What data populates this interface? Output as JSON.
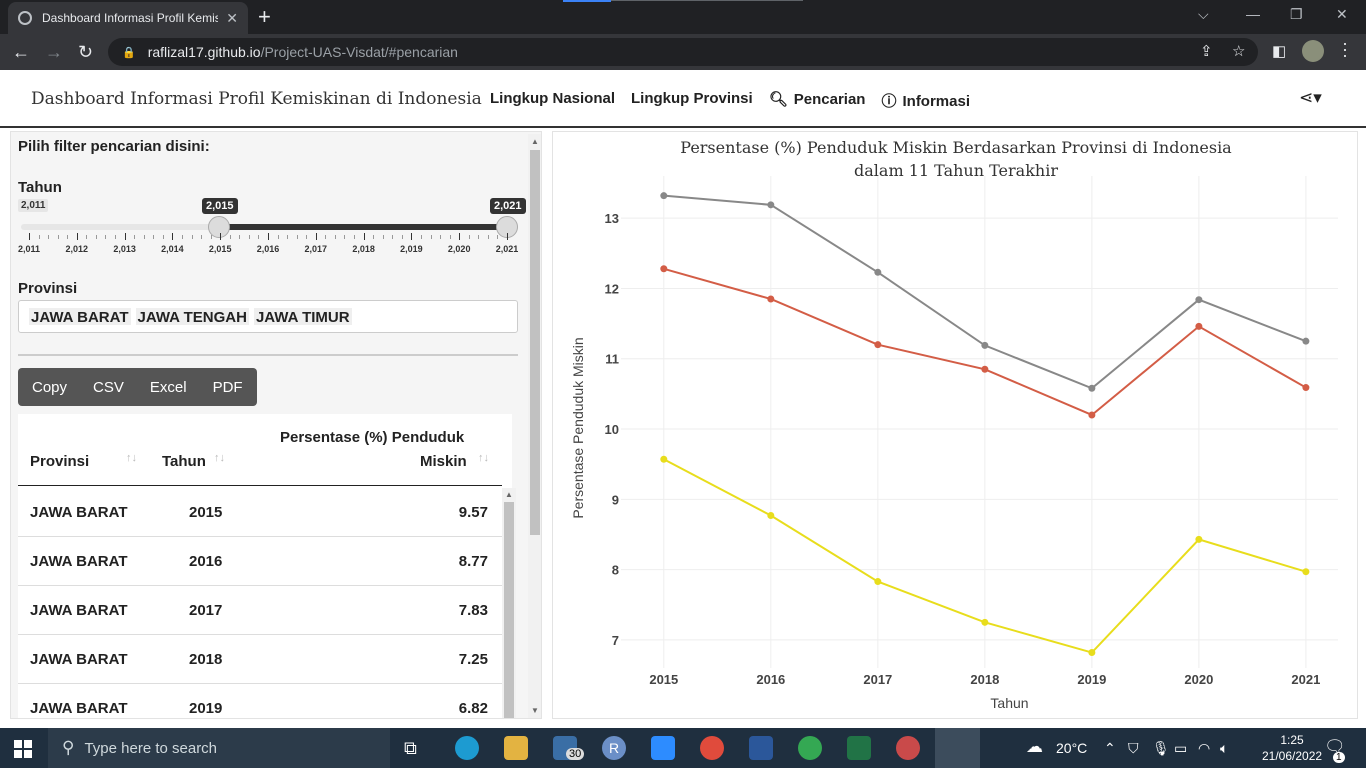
{
  "browser": {
    "tab_title": "Dashboard Informasi Profil Kemis",
    "url_host": "raflizal17.github.io",
    "url_path": "/Project-UAS-Visdat/#pencarian"
  },
  "navbar": {
    "brand": "Dashboard Informasi Profil Kemiskinan di Indonesia",
    "links": [
      "Lingkup Nasional",
      "Lingkup Provinsi",
      "Pencarian",
      "Informasi"
    ]
  },
  "sidebar": {
    "filter_title": "Pilih filter pencarian disini:",
    "tahun_label": "Tahun",
    "slider_min_label": "2,011",
    "slider_from": "2,015",
    "slider_to": "2,021",
    "ticks": [
      "2,011",
      "2,012",
      "2,013",
      "2,014",
      "2,015",
      "2,016",
      "2,017",
      "2,018",
      "2,019",
      "2,020",
      "2,021"
    ],
    "provinsi_label": "Provinsi",
    "selected_provinces": [
      "JAWA BARAT",
      "JAWA TENGAH",
      "JAWA TIMUR"
    ]
  },
  "export_buttons": [
    "Copy",
    "CSV",
    "Excel",
    "PDF"
  ],
  "table": {
    "headers": [
      "Provinsi",
      "Tahun",
      "Persentase (%) Penduduk",
      "Miskin"
    ],
    "rows": [
      [
        "JAWA BARAT",
        "2015",
        "9.57"
      ],
      [
        "JAWA BARAT",
        "2016",
        "8.77"
      ],
      [
        "JAWA BARAT",
        "2017",
        "7.83"
      ],
      [
        "JAWA BARAT",
        "2018",
        "7.25"
      ],
      [
        "JAWA BARAT",
        "2019",
        "6.82"
      ]
    ]
  },
  "chart_data": {
    "type": "line",
    "title_line1": "Persentase (%) Penduduk Miskin Berdasarkan Provinsi di Indonesia",
    "title_line2": "dalam 11 Tahun Terakhir",
    "xlabel": "Tahun",
    "ylabel": "Persentase Penduduk Miskin",
    "x": [
      2015,
      2016,
      2017,
      2018,
      2019,
      2020,
      2021
    ],
    "x_tick_labels": [
      "2015",
      "2016",
      "2017",
      "2018",
      "2019",
      "2020",
      "2021"
    ],
    "y_ticks": [
      7,
      8,
      9,
      10,
      11,
      12,
      13
    ],
    "ylim": [
      6.6,
      13.6
    ],
    "grid": true,
    "series": [
      {
        "color": "#888888",
        "values": [
          13.32,
          13.19,
          12.23,
          11.19,
          10.58,
          11.84,
          11.25
        ]
      },
      {
        "color": "#d35d46",
        "values": [
          12.28,
          11.85,
          11.2,
          10.85,
          10.2,
          11.46,
          10.59
        ]
      },
      {
        "color": "#e8dd1c",
        "values": [
          9.57,
          8.77,
          7.83,
          7.25,
          6.82,
          8.43,
          7.97
        ]
      }
    ]
  },
  "taskbar": {
    "search_placeholder": "Type here to search",
    "mail_badge": "30",
    "weather": "20°C",
    "time": "1:25",
    "date": "21/06/2022",
    "notif_count": "1"
  }
}
